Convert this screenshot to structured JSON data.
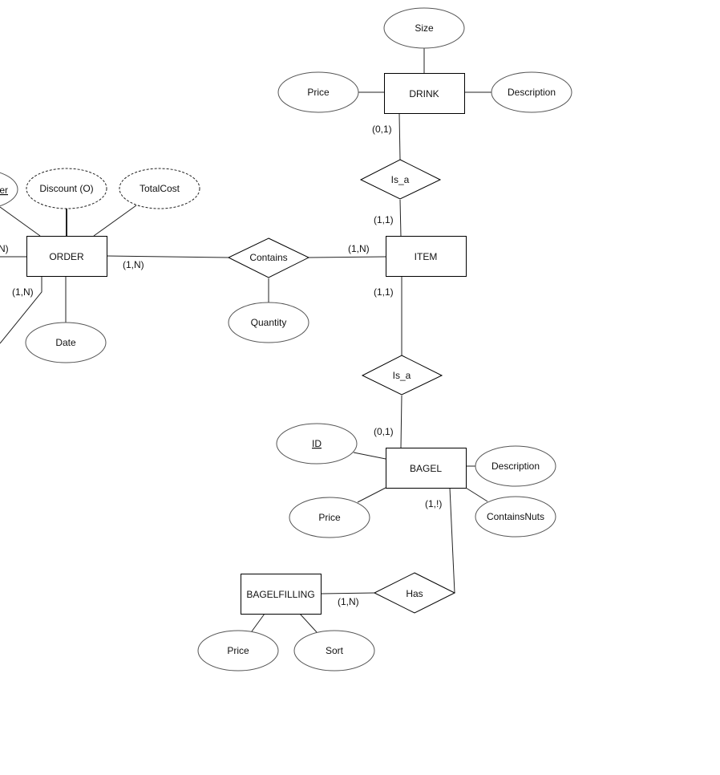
{
  "diagram": {
    "type": "entity-relationship",
    "entities": [
      {
        "id": "order",
        "label": "ORDER"
      },
      {
        "id": "item",
        "label": "ITEM"
      },
      {
        "id": "drink",
        "label": "DRINK"
      },
      {
        "id": "bagel",
        "label": "BAGEL"
      },
      {
        "id": "bagelfilling",
        "label": "BAGELFILLING"
      }
    ],
    "relationships": [
      {
        "id": "contains",
        "label": "Contains"
      },
      {
        "id": "isa_drink",
        "label": "Is_a"
      },
      {
        "id": "isa_bagel",
        "label": "Is_a"
      },
      {
        "id": "has",
        "label": "Has"
      }
    ],
    "attributes": [
      {
        "id": "order_partial_key",
        "label": "er",
        "owner": "order",
        "key": true
      },
      {
        "id": "order_discount",
        "label": "Discount (O)",
        "owner": "order",
        "derived_or_optional": true
      },
      {
        "id": "order_totalcost",
        "label": "TotalCost",
        "owner": "order",
        "derived_or_optional": true
      },
      {
        "id": "order_date",
        "label": "Date",
        "owner": "order"
      },
      {
        "id": "contains_quantity",
        "label": "Quantity",
        "owner": "contains"
      },
      {
        "id": "drink_size",
        "label": "Size",
        "owner": "drink"
      },
      {
        "id": "drink_price",
        "label": "Price",
        "owner": "drink"
      },
      {
        "id": "drink_description",
        "label": "Description",
        "owner": "drink"
      },
      {
        "id": "bagel_id",
        "label": "ID",
        "owner": "bagel",
        "key": true
      },
      {
        "id": "bagel_description",
        "label": "Description",
        "owner": "bagel"
      },
      {
        "id": "bagel_price",
        "label": "Price",
        "owner": "bagel"
      },
      {
        "id": "bagel_containsnuts",
        "label": "ContainsNuts",
        "owner": "bagel"
      },
      {
        "id": "filling_price",
        "label": "Price",
        "owner": "bagelfilling"
      },
      {
        "id": "filling_sort",
        "label": "Sort",
        "owner": "bagelfilling"
      }
    ],
    "cardinalities": {
      "order_left": "N)",
      "order_bottom_left": "(1,N)",
      "order_contains": "(1,N)",
      "item_contains": "(1,N)",
      "drink_isa": "(0,1)",
      "item_isa_drink": "(1,1)",
      "item_isa_bagel": "(1,1)",
      "bagel_isa": "(0,1)",
      "bagel_has": "(1,!)",
      "bagelfilling_has": "(1,N)"
    }
  }
}
